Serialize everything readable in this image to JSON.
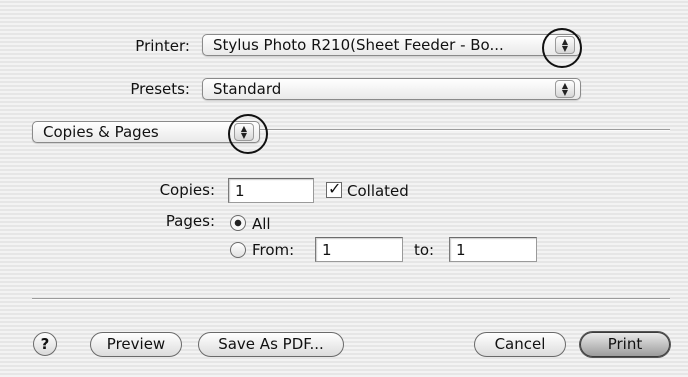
{
  "printer": {
    "label": "Printer:",
    "value": "Stylus Photo R210(Sheet Feeder - Bo..."
  },
  "presets": {
    "label": "Presets:",
    "value": "Standard"
  },
  "panel": {
    "value": "Copies & Pages"
  },
  "copies": {
    "label": "Copies:",
    "value": "1",
    "collated_label": "Collated",
    "collated_checked": true
  },
  "pages": {
    "label": "Pages:",
    "all_label": "All",
    "from_label": "From:",
    "from_value": "1",
    "to_label": "to:",
    "to_value": "1",
    "selected": "All"
  },
  "buttons": {
    "help": "?",
    "preview": "Preview",
    "save_as_pdf": "Save As PDF...",
    "cancel": "Cancel",
    "print": "Print"
  },
  "glyphs": {
    "popup_arrows": "▲▼",
    "checkmark": "✓"
  }
}
